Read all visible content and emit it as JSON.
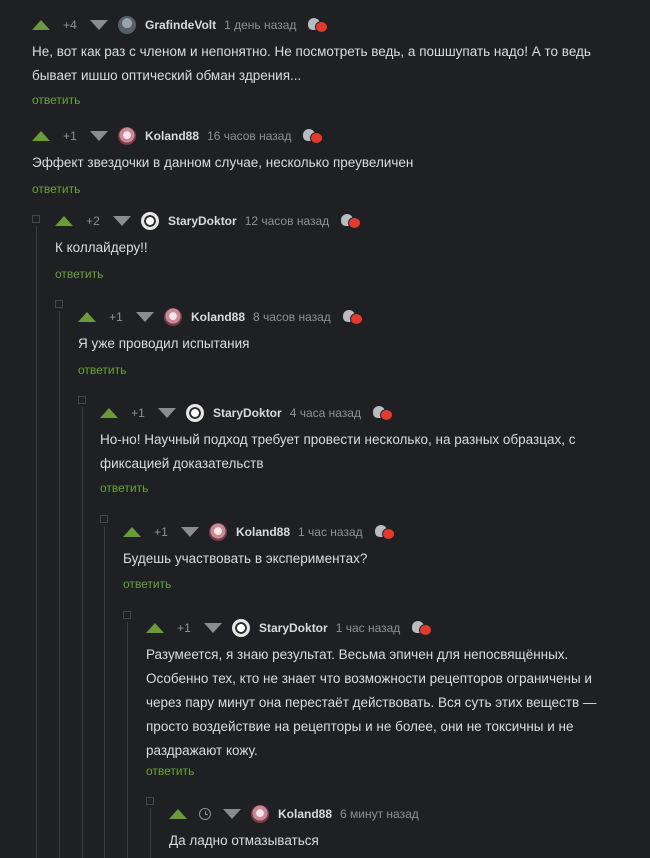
{
  "comments": [
    {
      "rating": "+4",
      "user": "GrafindeVolt",
      "time": "1 день назад",
      "avatar": "grafinde",
      "text_lines": [
        "Не, вот как раз с членом и непонятно. Не посмотреть ведь, а пошшупать надо! А то ведь",
        "бывает ишшо оптический обман здрения..."
      ],
      "reply": "ответить"
    },
    {
      "rating": "+1",
      "user": "Koland88",
      "time": "16 часов назад",
      "avatar": "koland",
      "text_lines": [
        "Эффект звездочки в данном случае, несколько преувеличен"
      ],
      "reply": "ответить"
    },
    {
      "rating": "+2",
      "user": "StaryDoktor",
      "time": "12 часов назад",
      "avatar": "stary",
      "text_lines": [
        "К коллайдеру!!"
      ],
      "reply": "ответить"
    },
    {
      "rating": "+1",
      "user": "Koland88",
      "time": "8 часов назад",
      "avatar": "koland",
      "text_lines": [
        "Я уже проводил испытания"
      ],
      "reply": "ответить"
    },
    {
      "rating": "+1",
      "user": "StaryDoktor",
      "time": "4 часа назад",
      "avatar": "stary",
      "text_lines": [
        "Но-но! Научный подход требует провести несколько, на разных образцах, с",
        "фиксацией доказательств"
      ],
      "reply": "ответить"
    },
    {
      "rating": "+1",
      "user": "Koland88",
      "time": "1 час назад",
      "avatar": "koland",
      "text_lines": [
        "Будешь участвовать в экспериментах?"
      ],
      "reply": "ответить"
    },
    {
      "rating": "+1",
      "user": "StaryDoktor",
      "time": "1 час назад",
      "avatar": "stary",
      "text_lines": [
        "Разумеется, я знаю результат. Весьма эпичен для непосвящённых.",
        "Особенно тех, кто не знает что возможности рецепторов ограничены и",
        "через пару минут она перестаёт действовать. Вся суть этих веществ —",
        "просто воздействие на рецепторы и не более, они не токсичны и не",
        "раздражают кожу."
      ],
      "reply": "ответить"
    },
    {
      "rating": "",
      "user": "Koland88",
      "time": "6 минут назад",
      "avatar": "koland",
      "text_lines": [
        "Да ладно отмазываться"
      ],
      "reply": ""
    }
  ]
}
